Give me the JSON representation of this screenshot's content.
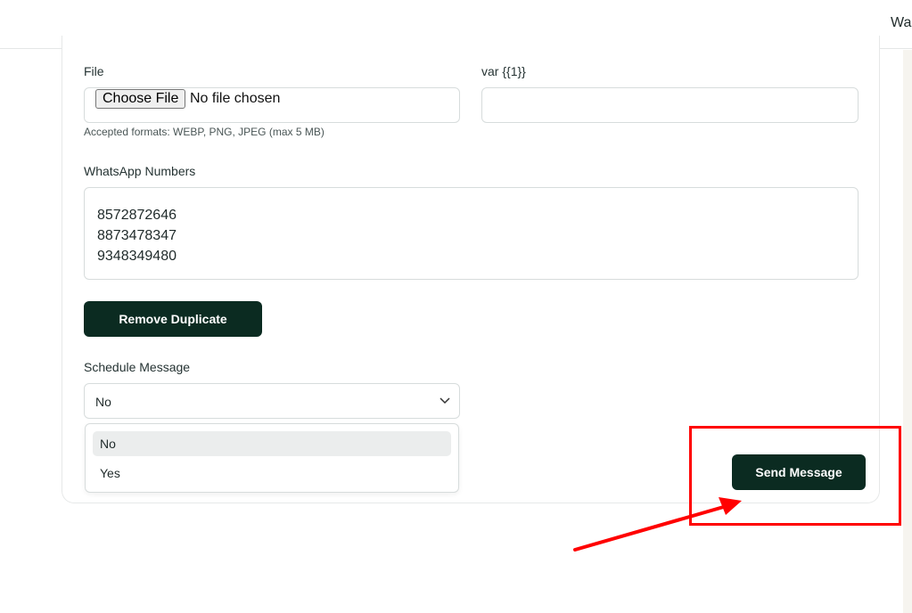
{
  "header": {
    "user_label": "Wa"
  },
  "form": {
    "file": {
      "label": "File",
      "button_label": "Choose File",
      "status": "No file chosen",
      "hint": "Accepted formats: WEBP, PNG, JPEG (max 5 MB)"
    },
    "var1": {
      "label": "var {{1}}",
      "value": ""
    },
    "numbers": {
      "label": "WhatsApp Numbers",
      "values": [
        "8572872646",
        "8873478347",
        "9348349480"
      ]
    },
    "remove_duplicate_label": "Remove Duplicate",
    "schedule": {
      "label": "Schedule Message",
      "selected": "No",
      "options": [
        "No",
        "Yes"
      ]
    },
    "send_label": "Send Message"
  },
  "colors": {
    "primary_button": "#0b2b21",
    "annotation": "#ff0000"
  }
}
